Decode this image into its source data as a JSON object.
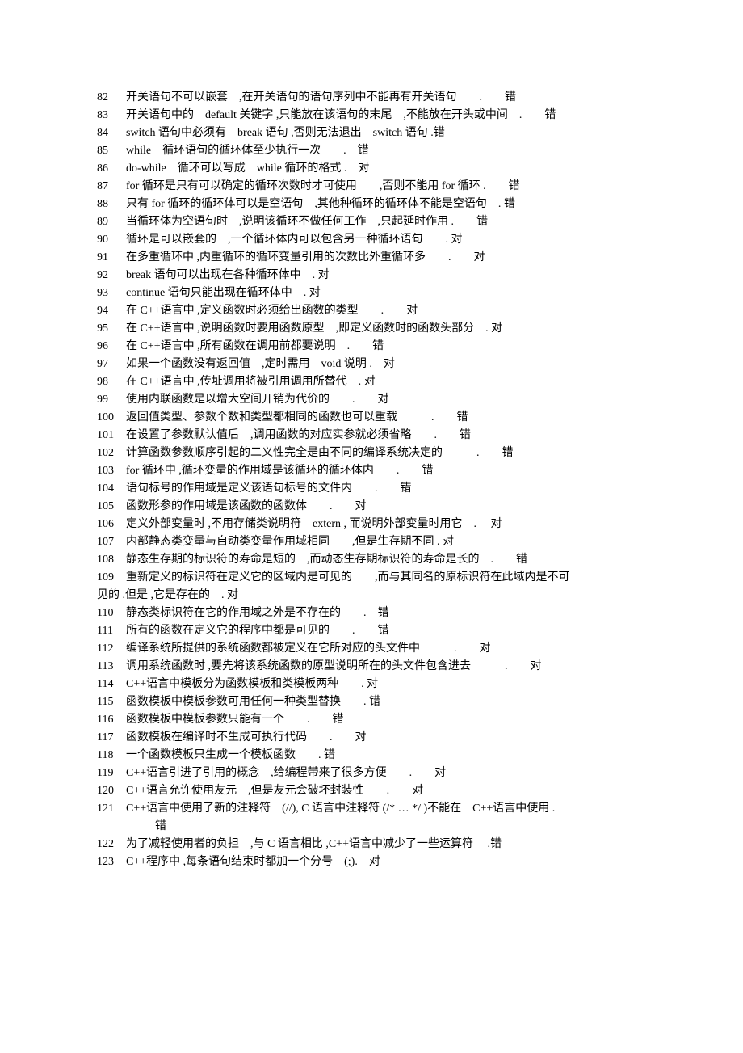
{
  "items": [
    {
      "num": "82",
      "text": "开关语句不可以嵌套　,在开关语句的语句序列中不能再有开关语句　　.　　错"
    },
    {
      "num": "83",
      "text": "开关语句中的　default 关键字 ,只能放在该语句的末尾　,不能放在开头或中间　.　　错"
    },
    {
      "num": "84",
      "text": "switch 语句中必须有　break 语句 ,否则无法退出　switch 语句 .错"
    },
    {
      "num": "85",
      "text": "while　循环语句的循环体至少执行一次　　.　错"
    },
    {
      "num": "86",
      "text": "do-while　循环可以写成　while 循环的格式 .　对"
    },
    {
      "num": "87",
      "text": "for 循环是只有可以确定的循环次数时才可使用　　,否则不能用 for 循环 .　　错"
    },
    {
      "num": "88",
      "text": "只有 for 循环的循环体可以是空语句　,其他种循环的循环体不能是空语句　. 错"
    },
    {
      "num": "89",
      "text": "当循环体为空语句时　,说明该循环不做任何工作　,只起延时作用 .　　错"
    },
    {
      "num": "90",
      "text": "循环是可以嵌套的　,一个循环体内可以包含另一种循环语句　　. 对"
    },
    {
      "num": "91",
      "text": "在多重循环中 ,内重循环的循环变量引用的次数比外重循环多　　.　　对"
    },
    {
      "num": "92",
      "text": "break 语句可以出现在各种循环体中　. 对"
    },
    {
      "num": "93",
      "text": "continue 语句只能出现在循环体中　. 对"
    },
    {
      "num": "94",
      "text": "在 C++语言中 ,定义函数时必须给出函数的类型　　.　　对"
    },
    {
      "num": "95",
      "text": "在 C++语言中 ,说明函数时要用函数原型　,即定义函数时的函数头部分　. 对"
    },
    {
      "num": "96",
      "text": "在 C++语言中 ,所有函数在调用前都要说明　.　　错"
    },
    {
      "num": "97",
      "text": "如果一个函数没有返回值　,定时需用　void 说明 .　对"
    },
    {
      "num": "98",
      "text": "在 C++语言中 ,传址调用将被引用调用所替代　. 对"
    },
    {
      "num": "99",
      "text": "使用内联函数是以增大空间开销为代价的　　.　　对"
    },
    {
      "num": "100",
      "text": "返回值类型、参数个数和类型都相同的函数也可以重载　　　.　　错"
    },
    {
      "num": "101",
      "text": "在设置了参数默认值后　,调用函数的对应实参就必须省略　　.　　错"
    },
    {
      "num": "102",
      "text": "计算函数参数顺序引起的二义性完全是由不同的编译系统决定的　　　.　　错"
    },
    {
      "num": "103",
      "text": "for 循环中 ,循环变量的作用域是该循环的循环体内　　.　　错"
    },
    {
      "num": "104",
      "text": "语句标号的作用域是定义该语句标号的文件内　　.　　错"
    },
    {
      "num": "105",
      "text": "函数形参的作用域是该函数的函数体　　.　　对"
    },
    {
      "num": "106",
      "text": "定义外部变量时 ,不用存储类说明符　extern , 而说明外部变量时用它　. 　对"
    },
    {
      "num": "107",
      "text": "内部静态类变量与自动类变量作用域相同　　,但是生存期不同 . 对"
    },
    {
      "num": "108",
      "text": "静态生存期的标识符的寿命是短的　,而动态生存期标识符的寿命是长的　.　　错"
    },
    {
      "num": "109",
      "text": "重新定义的标识符在定义它的区域内是可见的　　,而与其同名的原标识符在此域内是不可"
    },
    {
      "num": "",
      "text": "见的 .但是 ,它是存在的　. 对",
      "noindent": true
    },
    {
      "num": "110",
      "text": "静态类标识符在它的作用域之外是不存在的　　.　错"
    },
    {
      "num": "111",
      "text": "所有的函数在定义它的程序中都是可见的　　.　　错"
    },
    {
      "num": "112",
      "text": "编译系统所提供的系统函数都被定义在它所对应的头文件中　　　.　　对"
    },
    {
      "num": "113",
      "text": "调用系统函数时 ,要先将该系统函数的原型说明所在的头文件包含进去　　　.　　对"
    },
    {
      "num": "114",
      "text": "C++语言中模板分为函数模板和类模板两种　　. 对"
    },
    {
      "num": "115",
      "text": "函数模板中模板参数可用任何一种类型替换　　. 错"
    },
    {
      "num": "116",
      "text": "函数模板中模板参数只能有一个　　.　　错"
    },
    {
      "num": "117",
      "text": "函数模板在编译时不生成可执行代码　　.　　对"
    },
    {
      "num": "118",
      "text": "一个函数模板只生成一个模板函数　　. 错"
    },
    {
      "num": "119",
      "text": "C++语言引进了引用的概念　,给编程带来了很多方便　　.　　对"
    },
    {
      "num": "120",
      "text": "C++语言允许使用友元　,但是友元会破坏封装性　　.　　对"
    },
    {
      "num": "121",
      "text": "C++语言中使用了新的注释符　(//),  C 语言中注释符 (/* … */ )不能在　C++语言中使用 ."
    },
    {
      "num": "",
      "text": "错",
      "indent": true
    },
    {
      "num": "122",
      "text": "为了减轻使用者的负担　,与 C 语言相比 ,C++语言中减少了一些运算符　 .错"
    },
    {
      "num": "123",
      "text": "C++程序中 ,每条语句结束时都加一个分号　(;).　对"
    }
  ]
}
